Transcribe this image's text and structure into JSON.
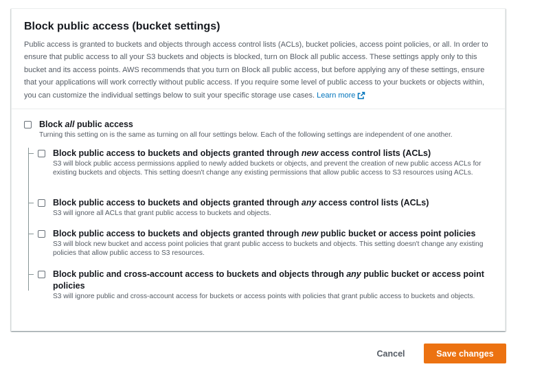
{
  "panel": {
    "title": "Block public access (bucket settings)",
    "description": "Public access is granted to buckets and objects through access control lists (ACLs), bucket policies, access point policies, or all. In order to ensure that public access to all your S3 buckets and objects is blocked, turn on Block all public access. These settings apply only to this bucket and its access points. AWS recommends that you turn on Block all public access, but before applying any of these settings, ensure that your applications will work correctly without public access. If you require some level of public access to your buckets or objects within, you can customize the individual settings below to suit your specific storage use cases.",
    "learn_more": "Learn more"
  },
  "block_all": {
    "title_pre": "Block ",
    "title_em": "all",
    "title_post": " public access",
    "description": "Turning this setting on is the same as turning on all four settings below. Each of the following settings are independent of one another.",
    "checked": false
  },
  "options": [
    {
      "title_pre": "Block public access to buckets and objects granted through ",
      "title_em": "new",
      "title_post": " access control lists (ACLs)",
      "description": "S3 will block public access permissions applied to newly added buckets or objects, and prevent the creation of new public access ACLs for existing buckets and objects. This setting doesn't change any existing permissions that allow public access to S3 resources using ACLs.",
      "checked": false
    },
    {
      "title_pre": "Block public access to buckets and objects granted through ",
      "title_em": "any",
      "title_post": " access control lists (ACLs)",
      "description": "S3 will ignore all ACLs that grant public access to buckets and objects.",
      "checked": false
    },
    {
      "title_pre": "Block public access to buckets and objects granted through ",
      "title_em": "new",
      "title_post": " public bucket or access point policies",
      "description": "S3 will block new bucket and access point policies that grant public access to buckets and objects. This setting doesn't change any existing policies that allow public access to S3 resources.",
      "checked": false
    },
    {
      "title_pre": "Block public and cross-account access to buckets and objects through ",
      "title_em": "any",
      "title_post": " public bucket or access point policies",
      "description": "S3 will ignore public and cross-account access for buckets or access points with policies that grant public access to buckets and objects.",
      "checked": false
    }
  ],
  "footer": {
    "cancel_label": "Cancel",
    "save_label": "Save changes"
  },
  "colors": {
    "primary_button": "#ec7211",
    "link": "#0073bb",
    "text": "#16191f",
    "secondary_text": "#545b64"
  },
  "icons": {
    "learn_more": "external-link-icon",
    "checkbox": "checkbox-unchecked-icon"
  }
}
